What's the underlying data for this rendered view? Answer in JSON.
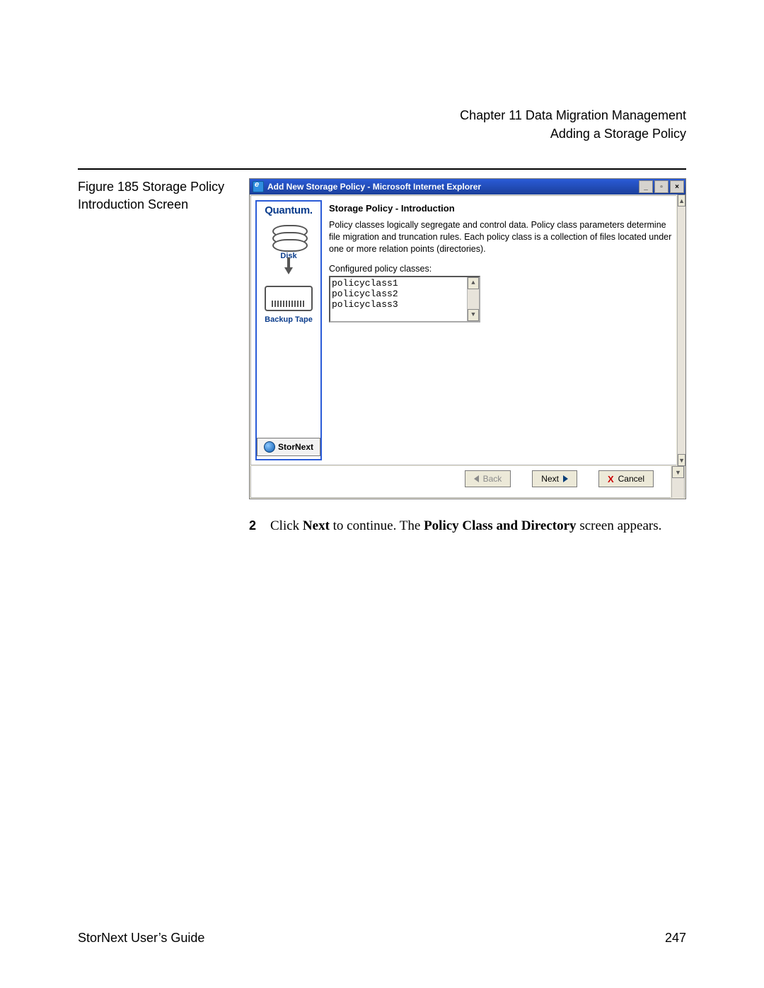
{
  "header": {
    "chapter": "Chapter 11  Data Migration Management",
    "section": "Adding a Storage Policy"
  },
  "figure": {
    "caption": "Figure 185  Storage Policy Introduction Screen",
    "window_title": "Add New Storage Policy - Microsoft Internet Explorer",
    "brand": "Quantum.",
    "sidebar": {
      "disk_label": "Disk",
      "tape_label": "Backup Tape",
      "product": "StorNext"
    },
    "content": {
      "title": "Storage Policy - Introduction",
      "description": "Policy classes logically segregate and control data. Policy class parameters determine file migration and truncation rules. Each policy class is a collection of files located under one or more relation points (directories).",
      "configured_label": "Configured policy classes:",
      "policy_classes": [
        "policyclass1",
        "policyclass2",
        "policyclass3"
      ]
    },
    "buttons": {
      "back": "Back",
      "next": "Next",
      "cancel": "Cancel"
    }
  },
  "step": {
    "number": "2",
    "pre": "Click ",
    "bold1": "Next",
    "mid": " to continue. The ",
    "bold2": "Policy Class and Directory",
    "post": " screen appears."
  },
  "footer": {
    "left": "StorNext User’s Guide",
    "right": "247"
  },
  "chart_data": null
}
